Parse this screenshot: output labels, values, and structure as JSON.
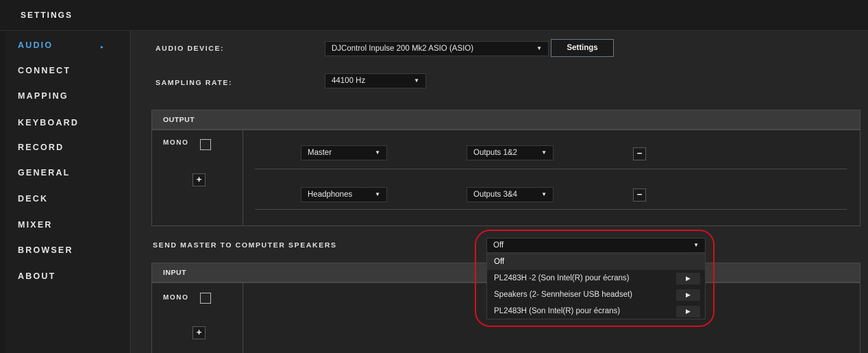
{
  "title": "SETTINGS",
  "sidebar": {
    "items": [
      {
        "label": "AUDIO",
        "active": true
      },
      {
        "label": "CONNECT"
      },
      {
        "label": "MAPPING"
      },
      {
        "label": "KEYBOARD"
      },
      {
        "label": "RECORD"
      },
      {
        "label": "GENERAL"
      },
      {
        "label": "DECK"
      },
      {
        "label": "MIXER"
      },
      {
        "label": "BROWSER"
      },
      {
        "label": "ABOUT"
      }
    ],
    "active_arrow": "▸"
  },
  "audio": {
    "device_label": "AUDIO DEVICE:",
    "device_value": "DJControl Inpulse 200 Mk2 ASIO (ASIO)",
    "settings_button": "Settings",
    "rate_label": "SAMPLING RATE:",
    "rate_value": "44100 Hz"
  },
  "output": {
    "header": "OUTPUT",
    "mono_label": "MONO",
    "add_icon": "+",
    "rows": [
      {
        "source": "Master",
        "dest": "Outputs 1&2",
        "remove": "−"
      },
      {
        "source": "Headphones",
        "dest": "Outputs 3&4",
        "remove": "−"
      }
    ]
  },
  "send_master": {
    "label": "SEND MASTER TO COMPUTER SPEAKERS",
    "value": "Off",
    "options": [
      {
        "label": "Off",
        "selected": true
      },
      {
        "label": "PL2483H -2 (Son Intel(R) pour écrans)",
        "play": "▶"
      },
      {
        "label": "Speakers (2- Sennheiser USB headset)",
        "play": "▶"
      },
      {
        "label": "PL2483H (Son Intel(R) pour écrans)",
        "play": "▶"
      }
    ]
  },
  "input": {
    "header": "INPUT",
    "mono_label": "MONO",
    "add_icon": "+"
  },
  "icons": {
    "caret": "▼"
  },
  "colors": {
    "accent": "#4fa3e3",
    "highlight": "#d4101d"
  }
}
